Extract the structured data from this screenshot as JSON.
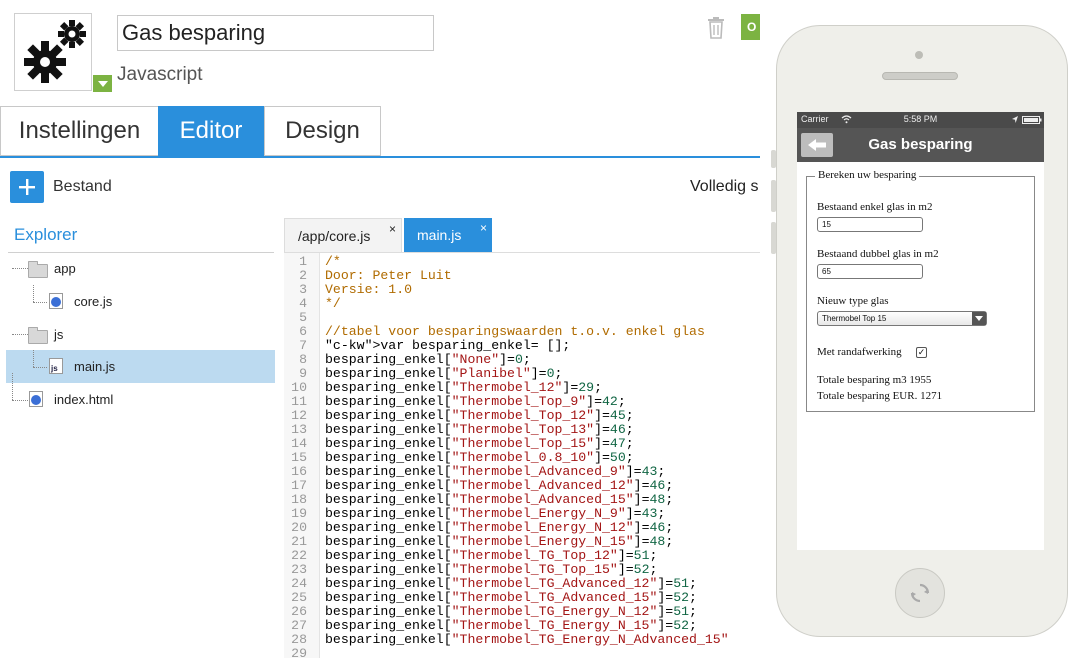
{
  "app": {
    "name": "Gas besparing",
    "type": "Javascript"
  },
  "header": {
    "action_partial": "O"
  },
  "tabs": [
    {
      "label": "Instellingen",
      "active": false
    },
    {
      "label": "Editor",
      "active": true
    },
    {
      "label": "Design",
      "active": false
    }
  ],
  "toolbar": {
    "add_label": "Bestand",
    "fullscreen_label": "Volledig s"
  },
  "explorer": {
    "title": "Explorer",
    "items": [
      {
        "label": "app",
        "kind": "folder"
      },
      {
        "label": "core.js",
        "kind": "file"
      },
      {
        "label": "js",
        "kind": "folder"
      },
      {
        "label": "main.js",
        "kind": "js-file",
        "selected": true
      },
      {
        "label": "index.html",
        "kind": "file"
      }
    ]
  },
  "editor": {
    "tabs": [
      {
        "label": "/app/core.js",
        "active": false
      },
      {
        "label": "main.js",
        "active": true
      }
    ],
    "close_glyph": "×",
    "lines": [
      "/*",
      "Door: Peter Luit",
      "Versie: 1.0",
      "*/",
      "",
      "//tabel voor besparingswaarden t.o.v. enkel glas",
      "var besparing_enkel= [];",
      "besparing_enkel[\"None\"]=0;",
      "besparing_enkel[\"Planibel\"]=0;",
      "besparing_enkel[\"Thermobel_12\"]=29;",
      "besparing_enkel[\"Thermobel_Top_9\"]=42;",
      "besparing_enkel[\"Thermobel_Top_12\"]=45;",
      "besparing_enkel[\"Thermobel_Top_13\"]=46;",
      "besparing_enkel[\"Thermobel_Top_15\"]=47;",
      "besparing_enkel[\"Thermobel_0.8_10\"]=50;",
      "besparing_enkel[\"Thermobel_Advanced_9\"]=43;",
      "besparing_enkel[\"Thermobel_Advanced_12\"]=46;",
      "besparing_enkel[\"Thermobel_Advanced_15\"]=48;",
      "besparing_enkel[\"Thermobel_Energy_N_9\"]=43;",
      "besparing_enkel[\"Thermobel_Energy_N_12\"]=46;",
      "besparing_enkel[\"Thermobel_Energy_N_15\"]=48;",
      "besparing_enkel[\"Thermobel_TG_Top_12\"]=51;",
      "besparing_enkel[\"Thermobel_TG_Top_15\"]=52;",
      "besparing_enkel[\"Thermobel_TG_Advanced_12\"]=51;",
      "besparing_enkel[\"Thermobel_TG_Advanced_15\"]=52;",
      "besparing_enkel[\"Thermobel_TG_Energy_N_12\"]=51;",
      "besparing_enkel[\"Thermobel_TG_Energy_N_15\"]=52;",
      "besparing_enkel[\"Thermobel_TG_Energy_N_Advanced_15\"",
      ""
    ]
  },
  "phone": {
    "status": {
      "carrier": "Carrier",
      "time": "5:58 PM"
    },
    "nav_title": "Gas besparing",
    "form": {
      "legend": "Bereken uw besparing",
      "single_label": "Bestaand enkel glas in m2",
      "single_value": "15",
      "double_label": "Bestaand dubbel glas in m2",
      "double_value": "65",
      "type_label": "Nieuw type glas",
      "type_value": "Thermobel Top 15",
      "edge_label": "Met randafwerking",
      "edge_checked": true,
      "check_glyph": "✓",
      "total_m3": "Totale besparing m3 1955",
      "total_eur": "Totale besparing EUR. 1271"
    }
  },
  "colors": {
    "accent": "#2a8fdc",
    "green": "#7cb342",
    "selected_row": "#bcdaf0"
  }
}
